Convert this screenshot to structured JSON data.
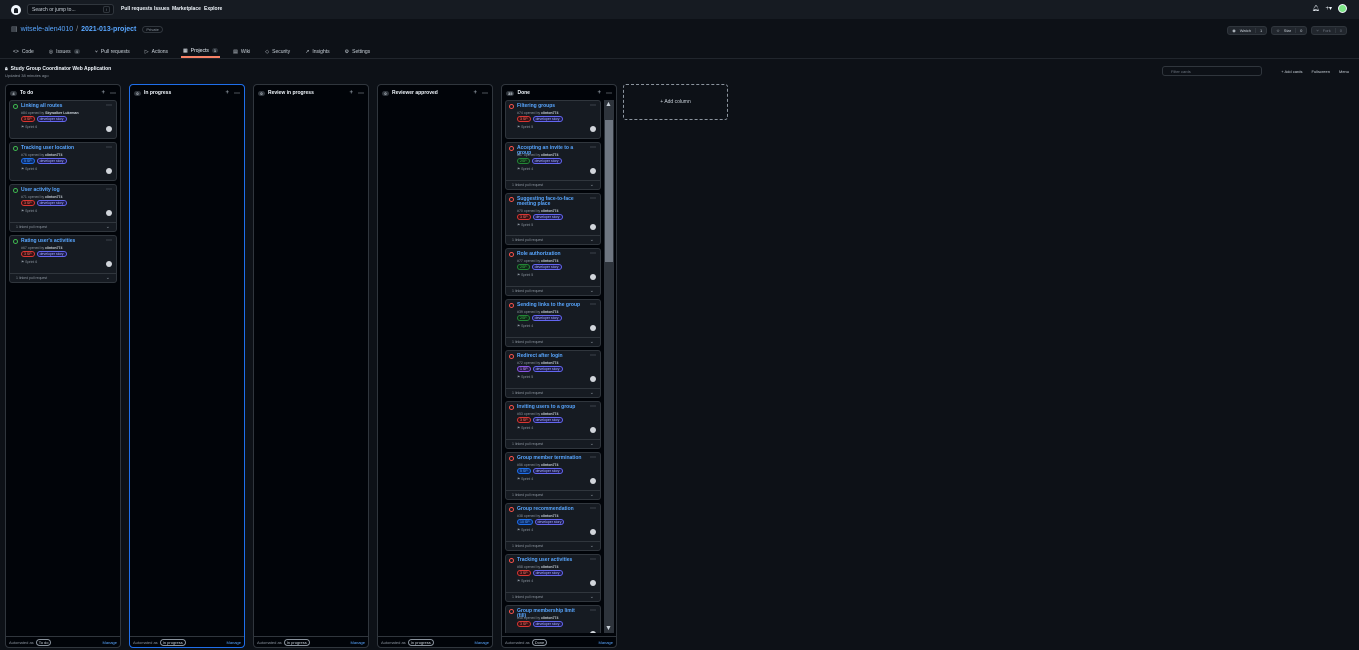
{
  "topnav": {
    "search_placeholder": "Search or jump to...",
    "search_kbd": "/",
    "links": [
      "Pull requests",
      "Issues",
      "Marketplace",
      "Explore"
    ]
  },
  "repo": {
    "owner": "witsele-alen4010",
    "name": "2021-013-project",
    "visibility": "Private"
  },
  "repo_actions": {
    "watch": "Watch",
    "watch_count": "1",
    "star": "Star",
    "star_count": "0",
    "fork": "Fork",
    "fork_count": "0"
  },
  "tabs": [
    {
      "label": "Code"
    },
    {
      "label": "Issues",
      "count": "4"
    },
    {
      "label": "Pull requests"
    },
    {
      "label": "Actions"
    },
    {
      "label": "Projects",
      "count": "1"
    },
    {
      "label": "Wiki"
    },
    {
      "label": "Security"
    },
    {
      "label": "Insights"
    },
    {
      "label": "Settings"
    }
  ],
  "project": {
    "title": "Study Group Coordinator Web Application",
    "updated": "Updated 38 minutes ago",
    "filter_placeholder": "Filter cards",
    "actions": [
      "+ Add cards",
      "Fullscreen",
      "Menu"
    ]
  },
  "columns": [
    {
      "name": "To do",
      "count": "4",
      "automated": "Automated as",
      "preset": "To do",
      "manage": "Manage"
    },
    {
      "name": "In progress",
      "count": "0",
      "automated": "Automated as",
      "preset": "In progress",
      "manage": "Manage"
    },
    {
      "name": "Review in progress",
      "count": "0",
      "automated": "Automated as",
      "preset": "In progress",
      "manage": "Manage"
    },
    {
      "name": "Reviewer approved",
      "count": "0",
      "automated": "Automated as",
      "preset": "In progress",
      "manage": "Manage"
    },
    {
      "name": "Done",
      "count": "35",
      "automated": "Automated as",
      "preset": "Done",
      "manage": "Manage"
    }
  ],
  "todo_cards": [
    {
      "title": "Linking all routes",
      "meta": "#84 opened by ",
      "author": "Skywalker Lukeman",
      "sp": "3 SP",
      "label": "developer story",
      "sprint": "Sprint 6",
      "linked": ""
    },
    {
      "title": "Tracking user location",
      "meta": "#76 opened by ",
      "author": "clinton774",
      "sp": "5 SP",
      "label": "developer story",
      "sprint": "Sprint 6",
      "linked": ""
    },
    {
      "title": "User activity log",
      "meta": "#71 opened by ",
      "author": "clinton774",
      "sp": "3 SP",
      "label": "developer story",
      "sprint": "Sprint 6",
      "linked": "1 linked pull request"
    },
    {
      "title": "Rating user's activities",
      "meta": "#67 opened by ",
      "author": "clinton774",
      "sp": "3 SP",
      "label": "developer story",
      "sprint": "Sprint 6",
      "linked": "1 linked pull request"
    }
  ],
  "done_cards": [
    {
      "title": "Filtering groups",
      "meta": "#74 opened by ",
      "author": "clinton774",
      "sp": "3 SP",
      "label": "developer story",
      "sprint": "Sprint 5",
      "linked": ""
    },
    {
      "title": "Accepting an invite to a group",
      "meta": "#67 opened by ",
      "author": "clinton774",
      "sp": "2SP",
      "label": "developer story",
      "sprint": "Sprint 4",
      "linked": "1 linked pull request"
    },
    {
      "title": "Suggesting face-to-face meeting place",
      "meta": "#70 opened by ",
      "author": "clinton774",
      "sp": "3 SP",
      "label": "developer story",
      "sprint": "Sprint 5",
      "linked": "1 linked pull request"
    },
    {
      "title": "Role authorization",
      "meta": "#77 opened by ",
      "author": "clinton774",
      "sp": "2SP",
      "label": "developer story",
      "sprint": "Sprint 5",
      "linked": "1 linked pull request"
    },
    {
      "title": "Sending links to the group",
      "meta": "#39 opened by ",
      "author": "clinton774",
      "sp": "2SP",
      "label": "developer story",
      "sprint": "Sprint 4",
      "linked": "1 linked pull request"
    },
    {
      "title": "Redirect after login",
      "meta": "#72 opened by ",
      "author": "clinton774",
      "sp": "1 SP",
      "label": "developer story",
      "sprint": "Sprint 5",
      "linked": "1 linked pull request"
    },
    {
      "title": "Inviting users to a group",
      "meta": "#53 opened by ",
      "author": "clinton774",
      "sp": "3 SP",
      "label": "developer story",
      "sprint": "Sprint 4",
      "linked": "1 linked pull request"
    },
    {
      "title": "Group member termination",
      "meta": "#56 opened by ",
      "author": "clinton774",
      "sp": "5 SP",
      "label": "developer story",
      "sprint": "Sprint 4",
      "linked": "1 linked pull request"
    },
    {
      "title": "Group recommendation",
      "meta": "#38 opened by ",
      "author": "clinton774",
      "sp": "10 SP",
      "label": "developer story",
      "sprint": "Sprint 4",
      "linked": "1 linked pull request"
    },
    {
      "title": "Tracking user activities",
      "meta": "#58 opened by ",
      "author": "clinton774",
      "sp": "3 SP",
      "label": "developer story",
      "sprint": "Sprint 4",
      "linked": "1 linked pull request"
    },
    {
      "title": "Group membership limit (fill)",
      "meta": "#48 opened by ",
      "author": "clinton774",
      "sp": "3 SP",
      "label": "developer story",
      "sprint": "",
      "linked": ""
    }
  ],
  "add_column": "+ Add column",
  "colors": {
    "bg": "#0d1117",
    "accent": "#58a6ff",
    "open": "#3fb950",
    "closed": "#f85149"
  }
}
